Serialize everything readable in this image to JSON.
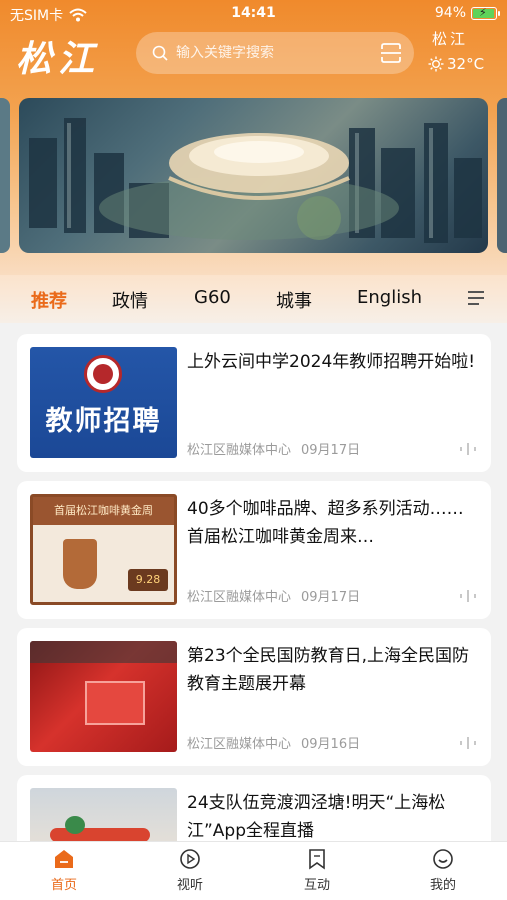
{
  "status_bar": {
    "carrier": "无SIM卡",
    "time": "14:41",
    "battery": "94%",
    "battery_level": 0.94
  },
  "header": {
    "logo": "松江",
    "search_placeholder": "输入关键字搜索",
    "weather": {
      "city": "松江",
      "temperature": "32°C"
    }
  },
  "tabs": [
    {
      "label": "推荐",
      "active": true
    },
    {
      "label": "政情",
      "active": false
    },
    {
      "label": "G60",
      "active": false
    },
    {
      "label": "城事",
      "active": false
    },
    {
      "label": "English",
      "active": false
    }
  ],
  "articles": [
    {
      "title": "上外云间中学2024年教师招聘开始啦!",
      "source": "松江区融媒体中心",
      "date": "09月17日",
      "thumb_text": "教师招聘"
    },
    {
      "title": "40多个咖啡品牌、超多系列活动……首届松江咖啡黄金周来…",
      "source": "松江区融媒体中心",
      "date": "09月17日",
      "thumb_text": "首届松江咖啡黄金周",
      "thumb_subtext": "9.28"
    },
    {
      "title": "第23个全民国防教育日,上海全民国防教育主题展开幕",
      "source": "松江区融媒体中心",
      "date": "09月16日"
    },
    {
      "title": "24支队伍竞渡泗泾塘!明天“上海松江”App全程直播",
      "source": "",
      "date": ""
    }
  ],
  "tabbar": [
    {
      "label": "首页",
      "icon": "home-icon",
      "active": true
    },
    {
      "label": "视听",
      "icon": "play-icon",
      "active": false
    },
    {
      "label": "互动",
      "icon": "bookmark-icon",
      "active": false
    },
    {
      "label": "我的",
      "icon": "smile-icon",
      "active": false
    }
  ],
  "colors": {
    "accent": "#ea6a1a",
    "header_top": "#f08a2c"
  }
}
